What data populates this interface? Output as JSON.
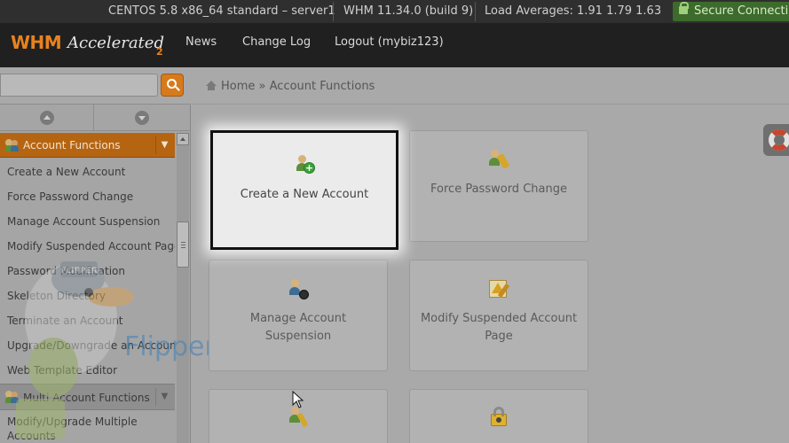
{
  "status_bar": {
    "os": "CENTOS 5.8 x86_64 standard – server1",
    "version": "WHM 11.34.0 (build 9)",
    "load": "Load Averages: 1.91 1.79 1.63",
    "secure": "Secure Connection"
  },
  "navbar": {
    "logo_whm": "WHM",
    "logo_accelerated": "Accelerated",
    "logo_version": "2",
    "links": [
      {
        "label": "News"
      },
      {
        "label": "Change Log"
      },
      {
        "label": "Logout (mybiz123)"
      }
    ]
  },
  "sidebar": {
    "search_placeholder": "",
    "section_title": "Account Functions",
    "items": [
      {
        "label": "Create a New Account"
      },
      {
        "label": "Force Password Change"
      },
      {
        "label": "Manage Account Suspension"
      },
      {
        "label": "Modify Suspended Account Page"
      },
      {
        "label": "Password Modification"
      },
      {
        "label": "Skeleton Directory"
      },
      {
        "label": "Terminate an Account"
      },
      {
        "label": "Upgrade/Downgrade an Account"
      },
      {
        "label": "Web Template Editor"
      }
    ],
    "section2_title": "Multi Account Functions",
    "section2_items": [
      {
        "label": "Modify/Upgrade Multiple Accounts"
      }
    ]
  },
  "breadcrumb": {
    "home": "Home",
    "separator": "»",
    "current": "Account Functions"
  },
  "tiles": [
    {
      "label": "Create a New Account",
      "icon": "add-user-icon",
      "highlighted": true
    },
    {
      "label": "Force Password Change",
      "icon": "password-user-icon",
      "highlighted": false
    },
    {
      "label": "Manage Account Suspension",
      "icon": "suspend-user-icon",
      "highlighted": false
    },
    {
      "label": "Modify Suspended Account Page",
      "icon": "warning-page-icon",
      "highlighted": false
    },
    {
      "label": "",
      "icon": "user-edit-icon",
      "highlighted": false
    },
    {
      "label": "",
      "icon": "lock-icon",
      "highlighted": false
    }
  ],
  "watermark": {
    "text": "FlipperHost",
    "badge": "FLIPPER"
  },
  "colors": {
    "accent_orange": "#d77a1b",
    "topbar": "#2f2f2f",
    "navbar": "#202020",
    "secure_green": "#3d6b2c"
  }
}
